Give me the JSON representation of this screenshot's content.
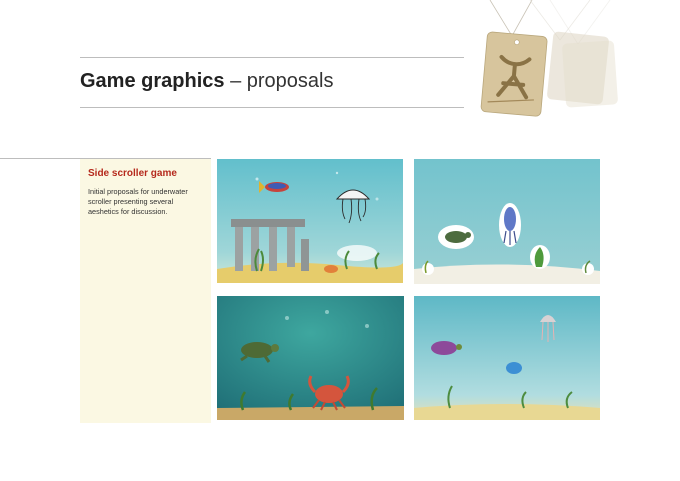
{
  "header": {
    "title_bold": "Game graphics",
    "title_rest": " – proposals"
  },
  "side_panel": {
    "heading": "Side scroller game",
    "description": "Initial proposals for underwater scroller presenting several aeshetics for discussion."
  },
  "colors": {
    "heading_red": "#b5291c",
    "panel_background": "#fbf8e3",
    "rule_gray": "#bdbdbd"
  },
  "icons": [
    "hanging-tag-logo",
    "ruins",
    "jellyfish",
    "fish",
    "turtle",
    "squid",
    "crab",
    "seaweed"
  ]
}
